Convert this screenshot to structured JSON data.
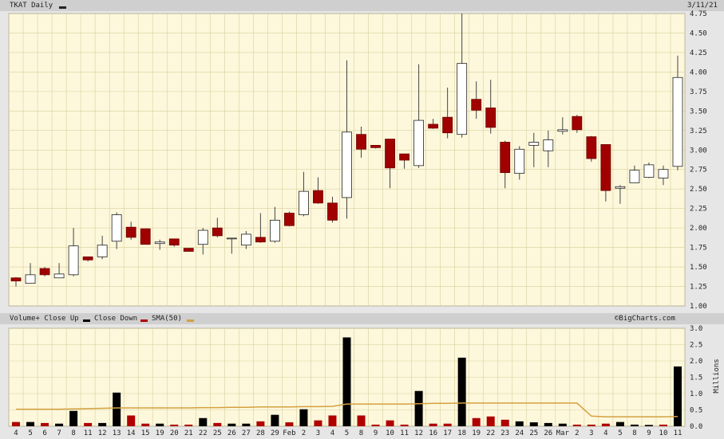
{
  "header": {
    "ticker_label": "TKAT Daily",
    "date": "3/11/21"
  },
  "legend": {
    "volume_up": "Volume+ Close Up",
    "close_down": "Close Down",
    "sma": "SMA(50)",
    "credit": "©BigCharts.com",
    "colors": {
      "up": "#000000",
      "down": "#b00000",
      "sma": "#d4a040"
    }
  },
  "colors": {
    "panel_bg": "#fdf8dc",
    "grid": "#d8cf9a",
    "up_body": "#ffffff",
    "down_body": "#a00000",
    "sma_line": "#d4a040"
  },
  "chart_data": [
    {
      "type": "candlestick",
      "title": "TKAT Daily",
      "ylim": [
        1.0,
        4.75
      ],
      "y_ticks": [
        "1.00",
        "1.25",
        "1.50",
        "1.75",
        "2.00",
        "2.25",
        "2.50",
        "2.75",
        "3.00",
        "3.25",
        "3.50",
        "3.75",
        "4.00",
        "4.25",
        "4.50",
        "4.75"
      ],
      "x_labels": [
        "4",
        "5",
        "6",
        "7",
        "8",
        "11",
        "12",
        "13",
        "14",
        "15",
        "19",
        "20",
        "21",
        "22",
        "25",
        "26",
        "27",
        "28",
        "29",
        "Feb",
        "2",
        "3",
        "4",
        "5",
        "8",
        "9",
        "10",
        "11",
        "12",
        "16",
        "17",
        "18",
        "19",
        "22",
        "23",
        "24",
        "25",
        "26",
        "Mar",
        "2",
        "3",
        "4",
        "5",
        "8",
        "9",
        "10",
        "11"
      ],
      "candles": [
        {
          "o": 1.36,
          "h": 1.37,
          "l": 1.25,
          "c": 1.32
        },
        {
          "o": 1.29,
          "h": 1.55,
          "l": 1.29,
          "c": 1.4
        },
        {
          "o": 1.48,
          "h": 1.5,
          "l": 1.38,
          "c": 1.4
        },
        {
          "o": 1.36,
          "h": 1.55,
          "l": 1.36,
          "c": 1.41
        },
        {
          "o": 1.4,
          "h": 2.0,
          "l": 1.38,
          "c": 1.77
        },
        {
          "o": 1.63,
          "h": 1.63,
          "l": 1.57,
          "c": 1.59
        },
        {
          "o": 1.63,
          "h": 1.9,
          "l": 1.6,
          "c": 1.78
        },
        {
          "o": 1.83,
          "h": 2.2,
          "l": 1.73,
          "c": 2.17
        },
        {
          "o": 2.01,
          "h": 2.08,
          "l": 1.85,
          "c": 1.88
        },
        {
          "o": 1.99,
          "h": 1.99,
          "l": 1.79,
          "c": 1.79
        },
        {
          "o": 1.8,
          "h": 1.85,
          "l": 1.72,
          "c": 1.82
        },
        {
          "o": 1.86,
          "h": 1.86,
          "l": 1.76,
          "c": 1.78
        },
        {
          "o": 1.74,
          "h": 1.74,
          "l": 1.7,
          "c": 1.7
        },
        {
          "o": 1.79,
          "h": 2.0,
          "l": 1.66,
          "c": 1.97
        },
        {
          "o": 2.0,
          "h": 2.13,
          "l": 1.88,
          "c": 1.9
        },
        {
          "o": 1.87,
          "h": 1.87,
          "l": 1.67,
          "c": 1.87
        },
        {
          "o": 1.78,
          "h": 1.96,
          "l": 1.73,
          "c": 1.92
        },
        {
          "o": 1.88,
          "h": 2.19,
          "l": 1.81,
          "c": 1.82
        },
        {
          "o": 1.83,
          "h": 2.27,
          "l": 1.81,
          "c": 2.1
        },
        {
          "o": 2.19,
          "h": 2.21,
          "l": 2.02,
          "c": 2.03
        },
        {
          "o": 2.17,
          "h": 2.72,
          "l": 2.15,
          "c": 2.47
        },
        {
          "o": 2.48,
          "h": 2.65,
          "l": 2.31,
          "c": 2.32
        },
        {
          "o": 2.32,
          "h": 2.4,
          "l": 2.07,
          "c": 2.1
        },
        {
          "o": 2.39,
          "h": 4.15,
          "l": 2.12,
          "c": 3.23
        },
        {
          "o": 3.2,
          "h": 3.3,
          "l": 2.9,
          "c": 3.01
        },
        {
          "o": 3.06,
          "h": 3.06,
          "l": 3.02,
          "c": 3.03
        },
        {
          "o": 3.14,
          "h": 3.14,
          "l": 2.51,
          "c": 2.77
        },
        {
          "o": 2.95,
          "h": 2.95,
          "l": 2.76,
          "c": 2.87
        },
        {
          "o": 2.8,
          "h": 4.1,
          "l": 2.77,
          "c": 3.38
        },
        {
          "o": 3.33,
          "h": 3.4,
          "l": 3.27,
          "c": 3.28
        },
        {
          "o": 3.42,
          "h": 3.8,
          "l": 3.15,
          "c": 3.22
        },
        {
          "o": 3.2,
          "h": 4.75,
          "l": 3.16,
          "c": 4.11
        },
        {
          "o": 3.65,
          "h": 3.88,
          "l": 3.4,
          "c": 3.51
        },
        {
          "o": 3.54,
          "h": 3.9,
          "l": 3.21,
          "c": 3.29
        },
        {
          "o": 3.1,
          "h": 3.12,
          "l": 2.51,
          "c": 2.71
        },
        {
          "o": 2.7,
          "h": 3.05,
          "l": 2.62,
          "c": 3.01
        },
        {
          "o": 3.06,
          "h": 3.22,
          "l": 2.78,
          "c": 3.1
        },
        {
          "o": 2.99,
          "h": 3.25,
          "l": 2.78,
          "c": 3.13
        },
        {
          "o": 3.24,
          "h": 3.42,
          "l": 3.2,
          "c": 3.26
        },
        {
          "o": 3.43,
          "h": 3.45,
          "l": 3.22,
          "c": 3.26
        },
        {
          "o": 3.17,
          "h": 3.18,
          "l": 2.85,
          "c": 2.89
        },
        {
          "o": 3.07,
          "h": 3.07,
          "l": 2.34,
          "c": 2.48
        },
        {
          "o": 2.51,
          "h": 2.55,
          "l": 2.31,
          "c": 2.53
        },
        {
          "o": 2.58,
          "h": 2.8,
          "l": 2.58,
          "c": 2.74
        },
        {
          "o": 2.65,
          "h": 2.84,
          "l": 2.64,
          "c": 2.81
        },
        {
          "o": 2.64,
          "h": 2.8,
          "l": 2.55,
          "c": 2.75
        },
        {
          "o": 2.79,
          "h": 4.21,
          "l": 2.74,
          "c": 3.93
        }
      ]
    },
    {
      "type": "bar",
      "title": "Volume",
      "ylabel": "Millions",
      "ylim": [
        0,
        3.0
      ],
      "y_ticks": [
        "0.0",
        "0.5",
        "1.0",
        "1.5",
        "2.0",
        "2.5",
        "3.0"
      ],
      "volume": [
        0.13,
        0.13,
        0.1,
        0.08,
        0.47,
        0.1,
        0.1,
        1.03,
        0.33,
        0.08,
        0.08,
        0.05,
        0.05,
        0.25,
        0.1,
        0.08,
        0.08,
        0.15,
        0.35,
        0.12,
        0.52,
        0.18,
        0.33,
        2.72,
        0.33,
        0.05,
        0.18,
        0.05,
        1.08,
        0.08,
        0.08,
        2.1,
        0.25,
        0.3,
        0.2,
        0.15,
        0.12,
        0.1,
        0.08,
        0.05,
        0.05,
        0.08,
        0.13,
        0.05,
        0.04,
        0.05,
        1.83
      ],
      "volume_up": [
        false,
        true,
        false,
        true,
        true,
        false,
        true,
        true,
        false,
        false,
        true,
        false,
        false,
        true,
        false,
        true,
        true,
        false,
        true,
        false,
        true,
        false,
        false,
        true,
        false,
        false,
        false,
        false,
        true,
        false,
        false,
        true,
        false,
        false,
        false,
        true,
        true,
        true,
        true,
        false,
        false,
        false,
        true,
        true,
        true,
        false,
        true
      ],
      "sma50": [
        0.52,
        0.52,
        0.52,
        0.52,
        0.53,
        0.54,
        0.55,
        0.56,
        0.56,
        0.56,
        0.56,
        0.56,
        0.56,
        0.57,
        0.57,
        0.58,
        0.58,
        0.59,
        0.59,
        0.59,
        0.6,
        0.6,
        0.61,
        0.68,
        0.68,
        0.68,
        0.68,
        0.68,
        0.69,
        0.7,
        0.7,
        0.71,
        0.71,
        0.71,
        0.71,
        0.71,
        0.71,
        0.71,
        0.71,
        0.71,
        0.31,
        0.29,
        0.29,
        0.29,
        0.29,
        0.29,
        0.3
      ]
    }
  ]
}
